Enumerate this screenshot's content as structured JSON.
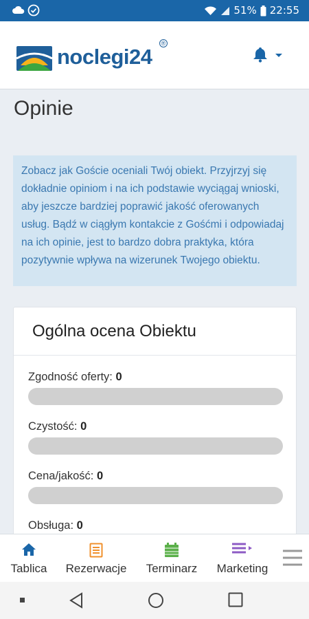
{
  "status_bar": {
    "battery": "51%",
    "time": "22:55"
  },
  "header": {
    "brand": "noclegi24",
    "reg_mark": "®"
  },
  "page": {
    "title": "Opinie"
  },
  "info_box": {
    "text": "Zobacz jak Goście oceniali Twój obiekt. Przyjrzyj się dokładnie opiniom i na ich podstawie wyciągaj wnioski, aby jeszcze bardziej poprawić jakość oferowanych usług. Bądź w ciągłym kontakcie z Gośćmi i odpowiadaj na ich opinie, jest to bardzo dobra praktyka, która pozytywnie wpływa na wizerunek Twojego obiektu."
  },
  "card": {
    "title": "Ogólna ocena Obiektu",
    "ratings": [
      {
        "label": "Zgodność oferty:",
        "value": "0",
        "fill": 0
      },
      {
        "label": "Czystość:",
        "value": "0",
        "fill": 0
      },
      {
        "label": "Cena/jakość:",
        "value": "0",
        "fill": 0
      },
      {
        "label": "Obsługa:",
        "value": "0",
        "fill": 0
      }
    ]
  },
  "bottom_nav": {
    "items": [
      {
        "label": "Tablica",
        "icon": "home-icon",
        "color": "#1a66a8"
      },
      {
        "label": "Rezerwacje",
        "icon": "list-icon",
        "color": "#f0902c"
      },
      {
        "label": "Terminarz",
        "icon": "calendar-icon",
        "color": "#5bb04a"
      },
      {
        "label": "Marketing",
        "icon": "megaphone-icon",
        "color": "#8d5bc4"
      }
    ]
  },
  "colors": {
    "primary": "#1a66a8",
    "info_bg": "#d3e5f2",
    "info_text": "#3a78b0"
  }
}
